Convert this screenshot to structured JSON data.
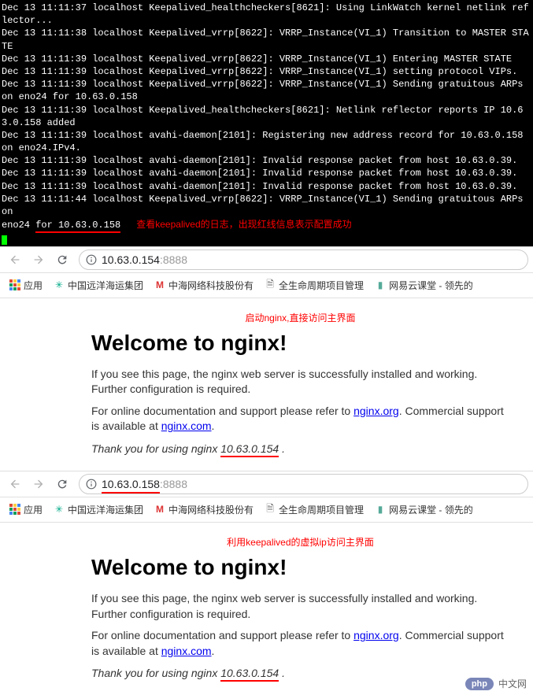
{
  "terminal": {
    "lines": [
      "Dec 13 11:11:37 localhost Keepalived_healthcheckers[8621]: Using LinkWatch kernel netlink reflector...",
      "Dec 13 11:11:38 localhost Keepalived_vrrp[8622]: VRRP_Instance(VI_1) Transition to MASTER STATE",
      "Dec 13 11:11:39 localhost Keepalived_vrrp[8622]: VRRP_Instance(VI_1) Entering MASTER STATE",
      "Dec 13 11:11:39 localhost Keepalived_vrrp[8622]: VRRP_Instance(VI_1) setting protocol VIPs.",
      "Dec 13 11:11:39 localhost Keepalived_vrrp[8622]: VRRP_Instance(VI_1) Sending gratuitous ARPs on eno24 for 10.63.0.158",
      "Dec 13 11:11:39 localhost Keepalived_healthcheckers[8621]: Netlink reflector reports IP 10.63.0.158 added",
      "Dec 13 11:11:39 localhost avahi-daemon[2101]: Registering new address record for 10.63.0.158 on eno24.IPv4.",
      "Dec 13 11:11:39 localhost avahi-daemon[2101]: Invalid response packet from host 10.63.0.39.",
      "Dec 13 11:11:39 localhost avahi-daemon[2101]: Invalid response packet from host 10.63.0.39.",
      "Dec 13 11:11:39 localhost avahi-daemon[2101]: Invalid response packet from host 10.63.0.39.",
      "Dec 13 11:11:44 localhost Keepalived_vrrp[8622]: VRRP_Instance(VI_1) Sending gratuitous ARPs on "
    ],
    "last_line_prefix": "eno24 ",
    "last_line_underlined": "for 10.63.0.158",
    "annotation": "查看keepalived的日志，出现红线信息表示配置成功"
  },
  "browser1": {
    "url_host": "10.63.0.154",
    "url_port": ":8888",
    "bookmarks": {
      "apps": "应用",
      "item1": "中国远洋海运集团",
      "item2": "中海网络科技股份有",
      "item3": "全生命周期项目管理",
      "item4": "网易云课堂 - 领先的"
    },
    "annotation": "启动nginx,直接访问主界面",
    "h1": "Welcome to nginx!",
    "p1": "If you see this page, the nginx web server is successfully installed and working. Further configuration is required.",
    "p2_prefix": "For online documentation and support please refer to ",
    "p2_link": "nginx.org",
    "p2_suffix": ". Commercial support is available at ",
    "p2_link2": "nginx.com",
    "p2_end": ".",
    "thanks_prefix": "Thank you for using nginx ",
    "thanks_ip": "10.63.0.154",
    "thanks_suffix": " ."
  },
  "browser2": {
    "url_host": "10.63.0.158",
    "url_port": ":8888",
    "bookmarks": {
      "apps": "应用",
      "item1": "中国远洋海运集团",
      "item2": "中海网络科技股份有",
      "item3": "全生命周期项目管理",
      "item4": "网易云课堂 - 领先的"
    },
    "annotation": "利用keepalived的虚拟ip访问主界面",
    "h1": "Welcome to nginx!",
    "p1": "If you see this page, the nginx web server is successfully installed and working. Further configuration is required.",
    "p2_prefix": "For online documentation and support please refer to ",
    "p2_link": "nginx.org",
    "p2_suffix": ". Commercial support is available at ",
    "p2_link2": "nginx.com",
    "p2_end": ".",
    "thanks_prefix": "Thank you for using nginx ",
    "thanks_ip": "10.63.0.154",
    "thanks_suffix": " ."
  },
  "watermark": {
    "badge": "php",
    "text": "中文网"
  }
}
